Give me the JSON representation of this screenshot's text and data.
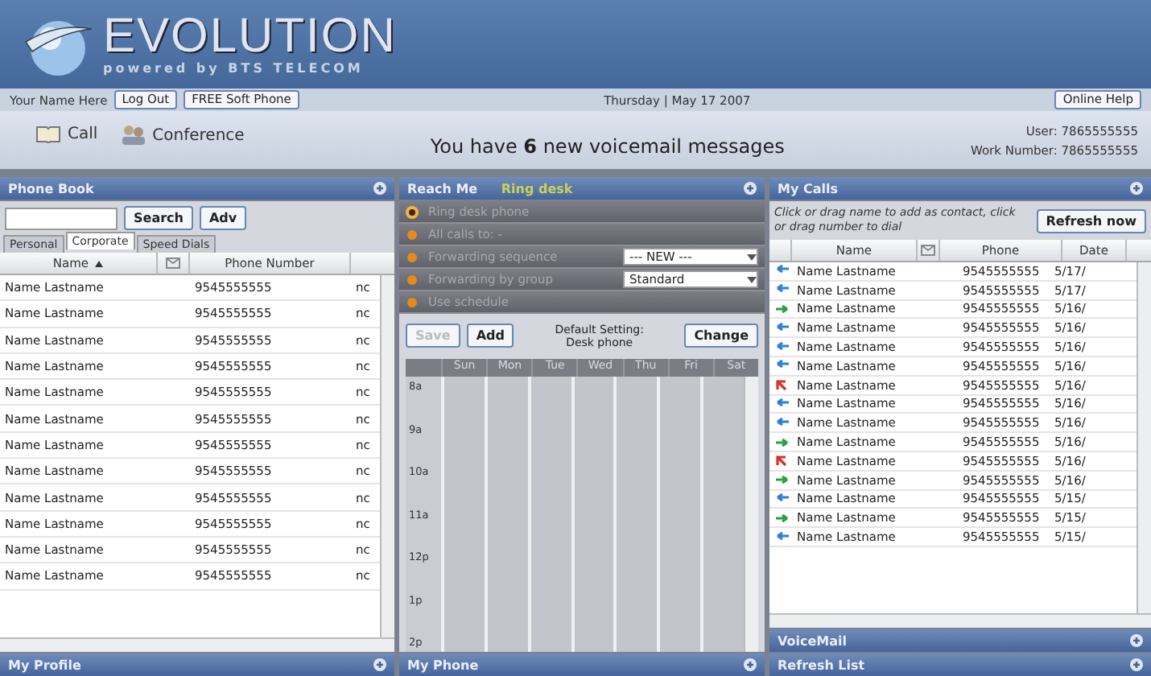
{
  "header": {
    "logo": "EVOLUTION",
    "tagline": "powered by BTS TELECOM"
  },
  "nav": {
    "user_name": "Your Name Here",
    "buttons": [
      "Log Out",
      "FREE Soft Phone"
    ],
    "date": "Thursday | May 17 2007",
    "help": "Online Help"
  },
  "actions": [
    {
      "kind": "call",
      "label": "Call"
    },
    {
      "kind": "conference",
      "label": "Conference"
    }
  ],
  "voicemail_notice": "You have **6** new voicemail messages",
  "account": {
    "user": "User: 7865555555",
    "work_number": "Work Number: 7865555555"
  },
  "phone_book": {
    "title": "Phone Book",
    "search_button": "Search",
    "adv_button": "Adv",
    "tabs": [
      {
        "label": "Personal",
        "selected": false
      },
      {
        "label": "Corporate",
        "selected": true
      },
      {
        "label": "Speed Dials",
        "selected": false
      }
    ],
    "columns": [
      "Name",
      "Phone Number"
    ],
    "rows": [
      {
        "name": "Name Lastname",
        "phone": "9545555555",
        "column_4": "nc"
      },
      {
        "name": "Name Lastname",
        "phone": "9545555555",
        "column_4": "nc"
      },
      {
        "name": "Name Lastname",
        "phone": "9545555555",
        "column_4": "nc"
      },
      {
        "name": "Name Lastname",
        "phone": "9545555555",
        "column_4": "nc"
      },
      {
        "name": "Name Lastname",
        "phone": "9545555555",
        "column_4": "nc"
      },
      {
        "name": "Name Lastname",
        "phone": "9545555555",
        "column_4": "nc"
      },
      {
        "name": "Name Lastname",
        "phone": "9545555555",
        "column_4": "nc"
      },
      {
        "name": "Name Lastname",
        "phone": "9545555555",
        "column_4": "nc"
      },
      {
        "name": "Name Lastname",
        "phone": "9545555555",
        "column_4": "nc"
      },
      {
        "name": "Name Lastname",
        "phone": "9545555555",
        "column_4": "nc"
      },
      {
        "name": "Name Lastname",
        "phone": "9545555555",
        "column_4": "nc"
      },
      {
        "name": "Name Lastname",
        "phone": "9545555555",
        "column_4": "nc"
      }
    ]
  },
  "reach_me": {
    "title": "Reach Me",
    "status": "Ring desk",
    "options": [
      {
        "label": "Ring desk phone",
        "selected": true
      },
      {
        "label": "All calls to: -",
        "selected": false
      },
      {
        "label": "Forwarding sequence",
        "selected": false,
        "dropdown": "--- NEW ---"
      },
      {
        "label": "Forwarding by group",
        "selected": false,
        "dropdown": "Standard"
      },
      {
        "label": "Use schedule",
        "selected": false
      }
    ],
    "buttons": [
      {
        "label": "Save",
        "disabled": true
      },
      {
        "label": "Add",
        "disabled": false
      }
    ],
    "default_setting": "Default Setting:",
    "default_value": "Desk phone",
    "change_button": "Change",
    "days": [
      "Sun",
      "Mon",
      "Tue",
      "Wed",
      "Thu",
      "Fri",
      "Sat"
    ],
    "hours": [
      "8a",
      "9a",
      "10a",
      "11a",
      "12p",
      "1p",
      "2p"
    ]
  },
  "my_calls": {
    "title": "My Calls",
    "hint": "Click or drag name to add as contact, click or drag number to dial",
    "refresh_button": "Refresh now",
    "columns": [
      "Name",
      "Phone",
      "Date"
    ],
    "rows": [
      {
        "kind": "incoming",
        "name": "Name Lastname",
        "phone": "9545555555",
        "date": "5/17/"
      },
      {
        "kind": "incoming",
        "name": "Name Lastname",
        "phone": "9545555555",
        "date": "5/17/"
      },
      {
        "kind": "outgoing",
        "name": "Name Lastname",
        "phone": "9545555555",
        "date": "5/16/"
      },
      {
        "kind": "incoming",
        "name": "Name Lastname",
        "phone": "9545555555",
        "date": "5/16/"
      },
      {
        "kind": "incoming",
        "name": "Name Lastname",
        "phone": "9545555555",
        "date": "5/16/"
      },
      {
        "kind": "incoming",
        "name": "Name Lastname",
        "phone": "9545555555",
        "date": "5/16/"
      },
      {
        "kind": "missed",
        "name": "Name Lastname",
        "phone": "9545555555",
        "date": "5/16/"
      },
      {
        "kind": "incoming",
        "name": "Name Lastname",
        "phone": "9545555555",
        "date": "5/16/"
      },
      {
        "kind": "incoming",
        "name": "Name Lastname",
        "phone": "9545555555",
        "date": "5/16/"
      },
      {
        "kind": "outgoing",
        "name": "Name Lastname",
        "phone": "9545555555",
        "date": "5/16/"
      },
      {
        "kind": "missed",
        "name": "Name Lastname",
        "phone": "9545555555",
        "date": "5/16/"
      },
      {
        "kind": "outgoing",
        "name": "Name Lastname",
        "phone": "9545555555",
        "date": "5/16/"
      },
      {
        "kind": "incoming",
        "name": "Name Lastname",
        "phone": "9545555555",
        "date": "5/15/"
      },
      {
        "kind": "outgoing",
        "name": "Name Lastname",
        "phone": "9545555555",
        "date": "5/15/"
      },
      {
        "kind": "incoming",
        "name": "Name Lastname",
        "phone": "9545555555",
        "date": "5/15/"
      }
    ]
  },
  "bottom_panels": {
    "left": "My Profile",
    "middle": "My Phone",
    "right": [
      "VoiceMail",
      "Refresh List"
    ]
  }
}
